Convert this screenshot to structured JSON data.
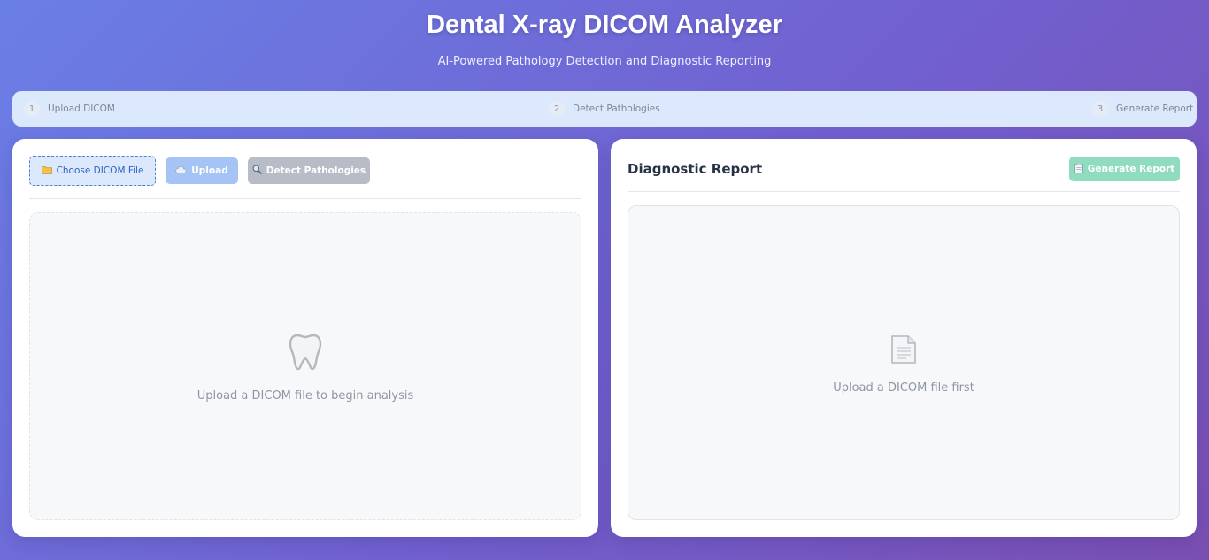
{
  "header": {
    "title": "Dental X-ray DICOM Analyzer",
    "subtitle": "AI-Powered Pathology Detection and Diagnostic Reporting"
  },
  "steps": [
    {
      "number": "1",
      "label": "Upload DICOM"
    },
    {
      "number": "2",
      "label": "Detect Pathologies"
    },
    {
      "number": "3",
      "label": "Generate Report"
    }
  ],
  "left_panel": {
    "choose_button": {
      "icon": "folder-icon",
      "label": "Choose DICOM File"
    },
    "upload_button": {
      "icon": "cloud-upload-icon",
      "label": "Upload"
    },
    "detect_button": {
      "icon": "magnifier-icon",
      "label": "Detect Pathologies"
    },
    "placeholder": {
      "icon": "tooth-icon",
      "text": "Upload a DICOM file to begin analysis"
    }
  },
  "right_panel": {
    "title": "Diagnostic Report",
    "generate_button": {
      "icon": "clipboard-icon",
      "label": "Generate Report"
    },
    "placeholder": {
      "icon": "document-icon",
      "text": "Upload a DICOM file first"
    }
  },
  "colors": {
    "accent_blue": "#2e63c4",
    "upload_disabled": "#a5c4f5",
    "detect_disabled": "#b7bcc6",
    "report_disabled": "#8fdcbf"
  }
}
